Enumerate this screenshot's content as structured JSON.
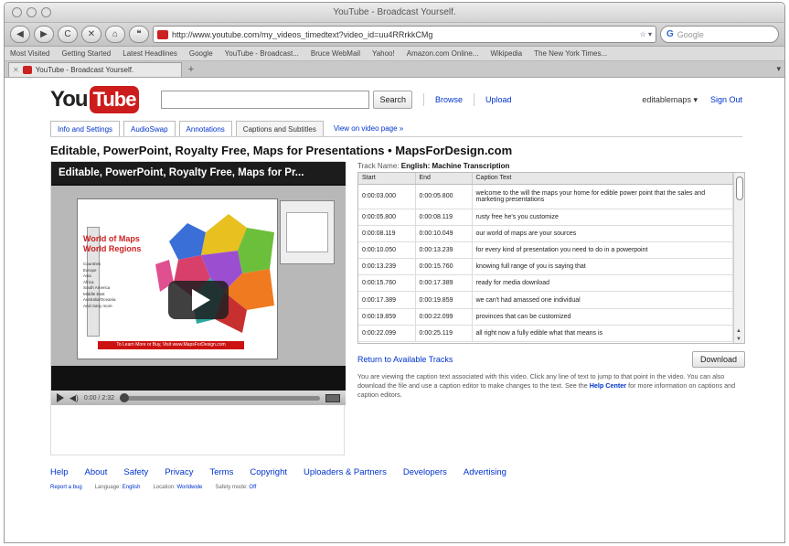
{
  "window": {
    "title": "YouTube - Broadcast Yourself."
  },
  "toolbar": {
    "back": "◀",
    "forward": "▶",
    "reload": "C",
    "stop": "✕",
    "home": "⌂",
    "bookmark": "❝",
    "url": "http://www.youtube.com/my_videos_timedtext?video_id=uu4RRrkkCMg",
    "rss": "☆ ▾",
    "search_placeholder": "Google"
  },
  "bookmarks": [
    "Most Visited",
    "Getting Started",
    "Latest Headlines",
    "Google",
    "YouTube - Broadcast...",
    "Bruce WebMail",
    "Yahoo!",
    "Amazon.com Online...",
    "Wikipedia",
    "The New York Times..."
  ],
  "tab": {
    "label": "YouTube - Broadcast Yourself.",
    "new_tab": "+",
    "menu": "▾"
  },
  "header": {
    "logo_you": "You",
    "logo_tube": "Tube",
    "search_value": "",
    "search_button": "Search",
    "browse": "Browse",
    "upload": "Upload",
    "username": "editablemaps ▾",
    "sign_out": "Sign Out"
  },
  "subtabs": [
    {
      "label": "Info and Settings"
    },
    {
      "label": "AudioSwap"
    },
    {
      "label": "Annotations"
    },
    {
      "label": "Captions and Subtitles"
    },
    {
      "label": "View on video page »"
    }
  ],
  "video": {
    "title": "Editable, PowerPoint, Royalty Free, Maps for Presentations • MapsForDesign.com",
    "player_title": "Editable, PowerPoint, Royalty Free, Maps for Pr...",
    "slide_title": "World of Maps\nWorld Regions",
    "slide_list": [
      "Countries",
      "Europe",
      "Asia",
      "Africa",
      "South America",
      "Middle East",
      "Australia/Oceania",
      "And many more"
    ],
    "slide_banner": "To Learn More or Buy, Visit www.MapsForDesign.com",
    "time": "0:00 / 2:32"
  },
  "captions": {
    "track_label": "Track Name:",
    "track_name": "English: Machine Transcription",
    "columns": [
      "Start",
      "End",
      "Caption Text"
    ],
    "rows": [
      {
        "start": "0:00:03.000",
        "end": "0:00:05.800",
        "text": "welcome to the will the maps your home for edible power point that the sales and marketing presentations"
      },
      {
        "start": "0:00:05.800",
        "end": "0:00:08.119",
        "text": "rusty free he's you customize"
      },
      {
        "start": "0:00:08.119",
        "end": "0:00:10.049",
        "text": "our world of maps are your sources"
      },
      {
        "start": "0:00:10.050",
        "end": "0:00:13.239",
        "text": "for every kind of presentation you need to do in a powerpoint"
      },
      {
        "start": "0:00:13.239",
        "end": "0:00:15.760",
        "text": "knowing full range of you is saying that"
      },
      {
        "start": "0:00:15.760",
        "end": "0:00:17.389",
        "text": "ready for media download"
      },
      {
        "start": "0:00:17.389",
        "end": "0:00:19.859",
        "text": "we can't had amassed one individual"
      },
      {
        "start": "0:00:19.859",
        "end": "0:00:22.099",
        "text": "provinces that can be customized"
      },
      {
        "start": "0:00:22.099",
        "end": "0:00:25.119",
        "text": "all right now a fully edible what that means is"
      }
    ],
    "return_link": "Return to Available Tracks",
    "download": "Download",
    "info_text_1": "You are viewing the caption text associated with this video. Click any line of text to jump to that point in the video. You can also download the file and use a caption editor to make changes to the text. See the",
    "help_center": "Help Center",
    "info_text_2": "for more information on captions and caption editors."
  },
  "footer": {
    "links": [
      "Help",
      "About",
      "Safety",
      "Privacy",
      "Terms",
      "Copyright",
      "Uploaders & Partners",
      "Developers",
      "Advertising"
    ],
    "report_bug": "Report a bug",
    "language_label": "Language:",
    "language": "English",
    "location_label": "Location:",
    "location": "Worldwide",
    "safety_label": "Safety mode:",
    "safety": "Off"
  }
}
